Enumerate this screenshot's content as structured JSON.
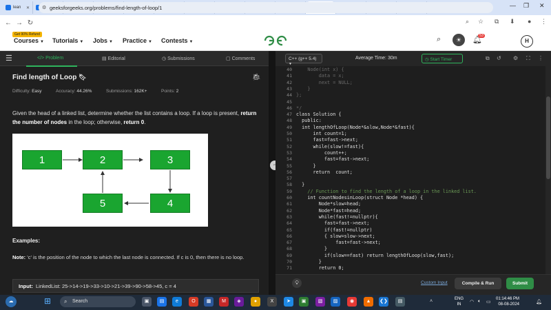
{
  "browser": {
    "tabs": [
      {
        "label": "lean",
        "color": "#1a73e8"
      },
      {
        "label": "Dat",
        "color": "#1a73e8"
      },
      {
        "label": "Cha",
        "color": "#333333"
      },
      {
        "label": "Adi",
        "color": "#1a73e8"
      },
      {
        "label": "Stri",
        "color": "#e53935"
      },
      {
        "label": "Dyr",
        "color": "#e53935"
      },
      {
        "label": "ber",
        "color": "#2f8d46"
      },
      {
        "label": "Ren",
        "color": "#2f8d46"
      },
      {
        "label": "(3)",
        "color": "#e53935"
      },
      {
        "label": "Rep",
        "color": "#222222"
      },
      {
        "label": "Fin",
        "color": "#2f8d46",
        "active": true
      },
      {
        "label": "ber",
        "color": "#2f8d46"
      },
      {
        "label": "Adi",
        "color": "#2f8d46"
      },
      {
        "label": "Ren",
        "color": "#2f8d46"
      }
    ],
    "tab_logos": {
      "stri": "TUF"
    },
    "new_tab": "+",
    "url": "geeksforgeeks.org/problems/find-length-of-loop/1",
    "window_controls": {
      "minimize": "—",
      "restore": "❐",
      "close": "✕"
    }
  },
  "header": {
    "refund_badge": "Get 90% Refund",
    "menu": [
      "Courses",
      "Tutorials",
      "Jobs",
      "Practice",
      "Contests"
    ],
    "logo": "GfG",
    "notifications": "53",
    "avatar": "H"
  },
  "left_tabs": [
    "Problem",
    "Editorial",
    "Submissions",
    "Comments"
  ],
  "problem": {
    "title": "Find length of Loop",
    "difficulty_label": "Difficulty:",
    "difficulty": "Easy",
    "accuracy_label": "Accuracy:",
    "accuracy": "44.26%",
    "submissions_label": "Submissions:",
    "submissions": "162K+",
    "points_label": "Points:",
    "points": "2",
    "desc_1": "Given the head of a linked list, determine whether the list contains a loop. If a loop is present, ",
    "desc_bold_1": "return the number of nodes",
    "desc_2": " in the loop; otherwise, ",
    "desc_bold_2": "return 0",
    "desc_3": ".",
    "nodes": [
      "1",
      "2",
      "3",
      "4",
      "5"
    ],
    "examples_heading": "Examples:",
    "note_label": "Note:",
    "note_text": " 'c' is the position of the node to which the last node is connected. If c is 0, then there is no loop.",
    "input_label": "Input:",
    "input_value": "LinkedList: 25->14->19->33->10->21->39->90->58->45, c = 4"
  },
  "editor": {
    "language": "C++ (g++ 5.4)",
    "avg_time": "Average Time: 30m",
    "timer": "Start Timer",
    "lines": [
      {
        "n": "40",
        "code": "    Node(int x) {",
        "c": "#6a6a6a"
      },
      {
        "n": "41",
        "code": "        data = x;",
        "c": "#6a6a6a"
      },
      {
        "n": "42",
        "code": "        next = NULL;",
        "c": "#6a6a6a"
      },
      {
        "n": "43",
        "code": "    }",
        "c": "#6a6a6a"
      },
      {
        "n": "44",
        "code": "};",
        "c": "#6a6a6a"
      },
      {
        "n": "45",
        "code": "",
        "c": "#d4d4d4"
      },
      {
        "n": "46",
        "code": "*/",
        "c": "#6a6a6a"
      },
      {
        "n": "47",
        "code": "class Solution {",
        "c": "#e0e0e0"
      },
      {
        "n": "48",
        "code": "  public:",
        "c": "#e0e0e0"
      },
      {
        "n": "49",
        "code": "  int lengthOfLoop(Node*&slow,Node*&fast){",
        "c": "#e0e0e0"
      },
      {
        "n": "50",
        "code": "      int count=1;",
        "c": "#e0e0e0"
      },
      {
        "n": "51",
        "code": "      fast=fast->next;",
        "c": "#e0e0e0"
      },
      {
        "n": "52",
        "code": "      while(slow!=fast){",
        "c": "#e0e0e0"
      },
      {
        "n": "53",
        "code": "          count++;",
        "c": "#e0e0e0"
      },
      {
        "n": "54",
        "code": "          fast=fast->next;",
        "c": "#e0e0e0"
      },
      {
        "n": "55",
        "code": "      }",
        "c": "#e0e0e0"
      },
      {
        "n": "56",
        "code": "      return  count;",
        "c": "#e0e0e0"
      },
      {
        "n": "57",
        "code": "",
        "c": "#e0e0e0"
      },
      {
        "n": "58",
        "code": "  }",
        "c": "#e0e0e0"
      },
      {
        "n": "59",
        "code": "    // Function to find the length of a loop in the linked list.",
        "c": "#6a9955"
      },
      {
        "n": "60",
        "code": "    int countNodesinLoop(struct Node *head) {",
        "c": "#e0e0e0"
      },
      {
        "n": "61",
        "code": "        Node*slow=head;",
        "c": "#e0e0e0"
      },
      {
        "n": "62",
        "code": "        Node*fast=head;",
        "c": "#e0e0e0"
      },
      {
        "n": "63",
        "code": "        while(fast!=nullptr){",
        "c": "#e0e0e0"
      },
      {
        "n": "64",
        "code": "          fast=fast->next;",
        "c": "#e0e0e0"
      },
      {
        "n": "65",
        "code": "          if(fast!=nullptr)",
        "c": "#e0e0e0"
      },
      {
        "n": "66",
        "code": "          { slow=slow->next;",
        "c": "#e0e0e0"
      },
      {
        "n": "67",
        "code": "              fast=fast->next;",
        "c": "#e0e0e0"
      },
      {
        "n": "68",
        "code": "          }",
        "c": "#e0e0e0"
      },
      {
        "n": "69",
        "code": "          if(slow==fast) return lengthOfLoop(slow,fast);",
        "c": "#e0e0e0"
      },
      {
        "n": "70",
        "code": "        }",
        "c": "#e0e0e0"
      },
      {
        "n": "71",
        "code": "        return 0;",
        "c": "#e0e0e0"
      }
    ],
    "custom_input": "Custom Input",
    "compile_run": "Compile & Run",
    "submit": "Submit"
  },
  "taskbar": {
    "search": "Search",
    "lang": "ENG",
    "region": "IN",
    "time": "01:14:46 PM",
    "date": "08-08-2024"
  },
  "colors": {
    "accent_green": "#2fb55d",
    "submit_green": "#2f8d46",
    "node_green": "#1aa530"
  }
}
